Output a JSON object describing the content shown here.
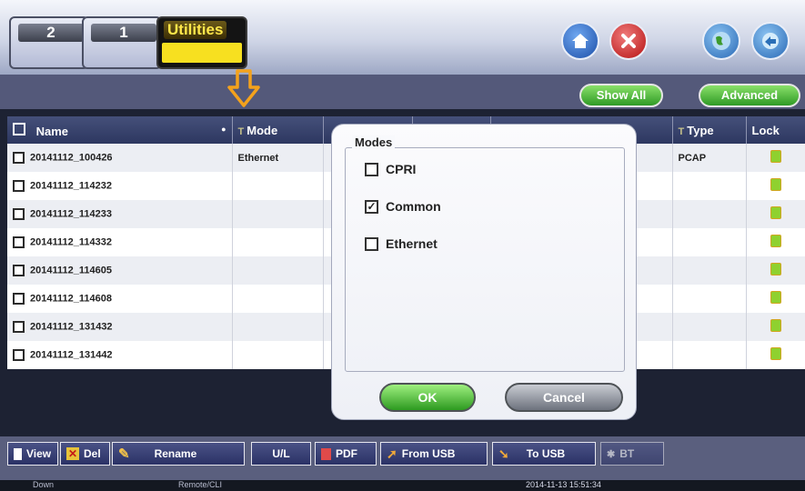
{
  "tabs": [
    {
      "label": "2"
    },
    {
      "label": "1"
    },
    {
      "label": "Utilities"
    }
  ],
  "toolbar": {
    "home_icon": "home-icon",
    "close_icon": "close-icon",
    "globe_icon": "globe-icon",
    "remote_icon": "remote-icon"
  },
  "header_buttons": {
    "show_all": "Show All",
    "advanced": "Advanced"
  },
  "table": {
    "columns": [
      {
        "label": "Name"
      },
      {
        "label": "Mode"
      },
      {
        "label": ""
      },
      {
        "label": ""
      },
      {
        "label": ""
      },
      {
        "label": "Type"
      },
      {
        "label": "Lock"
      }
    ],
    "rows": [
      {
        "name": "20141112_100426",
        "mode": "Ethernet",
        "type": "PCAP"
      },
      {
        "name": "20141112_114232",
        "mode": "",
        "type": ""
      },
      {
        "name": "20141112_114233",
        "mode": "",
        "type": ""
      },
      {
        "name": "20141112_114332",
        "mode": "",
        "type": ""
      },
      {
        "name": "20141112_114605",
        "mode": "",
        "type": ""
      },
      {
        "name": "20141112_114608",
        "mode": "",
        "type": ""
      },
      {
        "name": "20141112_131432",
        "mode": "",
        "type": ""
      },
      {
        "name": "20141112_131442",
        "mode": "",
        "type": ""
      }
    ]
  },
  "modes_dialog": {
    "title": "Modes",
    "options": [
      {
        "label": "CPRI",
        "checked": false
      },
      {
        "label": "Common",
        "checked": true
      },
      {
        "label": "Ethernet",
        "checked": false
      }
    ],
    "ok": "OK",
    "cancel": "Cancel"
  },
  "bottom_buttons": [
    {
      "label": "View"
    },
    {
      "label": "Del"
    },
    {
      "label": "Rename"
    },
    {
      "label": "U/L"
    },
    {
      "label": "PDF"
    },
    {
      "label": "From USB"
    },
    {
      "label": "To USB"
    },
    {
      "label": "BT"
    }
  ],
  "status_bar": {
    "left": "Down",
    "center": "Remote/CLI",
    "datetime": "2014-11-13 15:51:34"
  }
}
